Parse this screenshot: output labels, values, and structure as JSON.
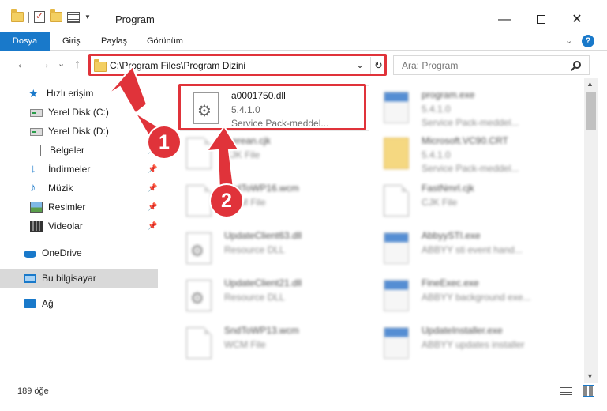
{
  "window": {
    "title": "Program",
    "minimize": "—",
    "close": "✕"
  },
  "ribbon": {
    "tabs": [
      "Dosya",
      "Giriş",
      "Paylaş",
      "Görünüm"
    ]
  },
  "nav": {
    "back": "←",
    "forward": "→",
    "recent": "⌄",
    "up": "↑",
    "address": "C:\\Program Files\\Program Dizini",
    "refresh": "↻",
    "search_placeholder": "Ara: Program"
  },
  "sidebar": {
    "items": [
      {
        "label": "Hızlı erişim",
        "icon": "star-icon"
      },
      {
        "label": "Yerel Disk (C:)",
        "icon": "drive-icon"
      },
      {
        "label": "Yerel Disk (D:)",
        "icon": "drive-icon"
      },
      {
        "label": "Belgeler",
        "icon": "documents-icon",
        "pinned": true
      },
      {
        "label": "İndirmeler",
        "icon": "downloads-icon",
        "pinned": true
      },
      {
        "label": "Müzik",
        "icon": "music-icon",
        "pinned": true
      },
      {
        "label": "Resimler",
        "icon": "pictures-icon",
        "pinned": true
      },
      {
        "label": "Videolar",
        "icon": "videos-icon",
        "pinned": true
      },
      {
        "label": "OneDrive",
        "icon": "cloud-icon"
      },
      {
        "label": "Bu bilgisayar",
        "icon": "computer-icon",
        "selected": true
      },
      {
        "label": "Ağ",
        "icon": "network-icon"
      }
    ]
  },
  "files": [
    {
      "name": "a0001750.dll",
      "version": "5.4.1.0",
      "desc": "Service Pack-meddel...",
      "icon": "dll-gear-icon",
      "highlighted": true
    },
    {
      "name": "program.exe",
      "version": "5.4.1.0",
      "desc": "Service Pack-meddel...",
      "icon": "exe-icon"
    },
    {
      "name": "...erean.cjk",
      "version": "CJK File",
      "desc": "",
      "icon": "file-icon"
    },
    {
      "name": "Microsoft.VC90.CRT",
      "version": "5.4.1.0",
      "desc": "Service Pack-meddel...",
      "icon": "folder-icon"
    },
    {
      "name": "SndToWP16.wcm",
      "version": "WCM File",
      "desc": "",
      "icon": "file-icon"
    },
    {
      "name": "FastNmrl.cjk",
      "version": "CJK File",
      "desc": "",
      "icon": "file-icon"
    },
    {
      "name": "UpdateClient63.dll",
      "version": "Resource DLL",
      "desc": "",
      "icon": "dll-gear-icon"
    },
    {
      "name": "AbbyySTI.exe",
      "version": "ABBYY sti event hand...",
      "desc": "",
      "icon": "exe-icon"
    },
    {
      "name": "UpdateClient21.dll",
      "version": "Resource DLL",
      "desc": "",
      "icon": "dll-gear-icon"
    },
    {
      "name": "FineExec.exe",
      "version": "ABBYY background exe...",
      "desc": "",
      "icon": "exe-icon"
    },
    {
      "name": "SndToWP13.wcm",
      "version": "WCM File",
      "desc": "",
      "icon": "file-icon"
    },
    {
      "name": "UpdateInstaller.exe",
      "version": "ABBYY updates installer",
      "desc": "",
      "icon": "exe-icon"
    }
  ],
  "status": {
    "item_count": "189 öğe"
  },
  "callouts": {
    "step1": "1",
    "step2": "2"
  },
  "colors": {
    "accent": "#1979ca",
    "highlight": "#e0333a"
  }
}
